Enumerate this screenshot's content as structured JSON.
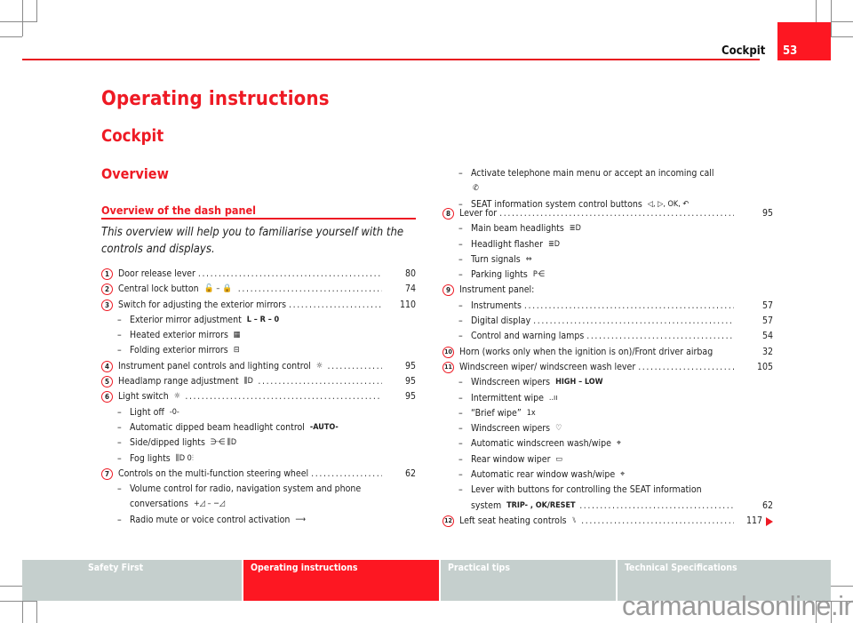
{
  "header": {
    "chapter": "Cockpit",
    "page_number": "53"
  },
  "titles": {
    "h1": "Operating instructions",
    "h2": "Cockpit",
    "h3": "Overview",
    "h4": "Overview of the dash panel",
    "intro": "This overview will help you to familiarise yourself with the controls and displays."
  },
  "left_items": [
    {
      "num": "1",
      "text": "Door release lever",
      "icon": "",
      "page": "80"
    },
    {
      "num": "2",
      "text": "Central lock button",
      "icon": "unlock-lock-icon",
      "glyph": "🔓 – 🔒",
      "page": "74"
    },
    {
      "num": "3",
      "text": "Switch for adjusting the exterior mirrors",
      "page": "110",
      "subs": [
        {
          "text": "Exterior mirror adjustment",
          "glyph": "L – R – 0",
          "icon": "mirror-select-icon"
        },
        {
          "text": "Heated exterior mirrors",
          "glyph": "▦",
          "icon": "heated-mirror-icon"
        },
        {
          "text": "Folding exterior mirrors",
          "glyph": "⊟",
          "icon": "folding-mirror-icon"
        }
      ]
    },
    {
      "num": "4",
      "text": "Instrument panel controls and lighting control",
      "glyph": "☼",
      "icon": "panel-lighting-icon",
      "page": "95"
    },
    {
      "num": "5",
      "text": "Headlamp range adjustment",
      "glyph": "⫼D",
      "icon": "headlamp-range-icon",
      "page": "95"
    },
    {
      "num": "6",
      "text": "Light switch",
      "glyph": "☼",
      "icon": "light-switch-icon",
      "page": "95",
      "subs": [
        {
          "text": "Light off",
          "glyph": "-0-",
          "icon": "light-off-icon"
        },
        {
          "text": "Automatic dipped beam headlight control",
          "glyph": "-AUTO-",
          "icon": "auto-light-icon"
        },
        {
          "text": "Side/dipped lights",
          "glyph": "⋺⋲ ⫼D",
          "icon": "side-dipped-lights-icon"
        },
        {
          "text": "Fog lights",
          "glyph": "⫼D 0⫶",
          "icon": "fog-lights-icon"
        }
      ]
    },
    {
      "num": "7",
      "text": "Controls on the multi-function steering wheel",
      "page": "62",
      "subs": [
        {
          "text": "Volume control for radio, navigation system and phone",
          "text2": "conversations",
          "glyph": "+◿ – −◿",
          "icon": "volume-icon"
        },
        {
          "text": "Radio mute or voice control activation",
          "glyph": "⟶",
          "icon": "mute-voice-icon"
        }
      ]
    }
  ],
  "right_continued": [
    {
      "text": "Activate telephone main menu or accept an incoming call",
      "glyph": "✆",
      "icon": "phone-icon"
    },
    {
      "text": "SEAT information system control buttons",
      "glyph": "◁, ▷, OK, ↶",
      "icon": "nav-buttons-icon"
    }
  ],
  "right_items": [
    {
      "num": "8",
      "text": "Lever for",
      "page": "95",
      "subs": [
        {
          "text": "Main beam headlights",
          "glyph": "≣D",
          "icon": "main-beam-icon"
        },
        {
          "text": "Headlight flasher",
          "glyph": "≣D",
          "icon": "flasher-icon"
        },
        {
          "text": "Turn signals",
          "glyph": "⇔",
          "icon": "turn-signal-icon"
        },
        {
          "text": "Parking lights",
          "glyph": "P⋲",
          "icon": "parking-lights-icon"
        }
      ]
    },
    {
      "num": "9",
      "text": "Instrument panel:",
      "page": "",
      "subs": [
        {
          "text": "Instruments",
          "page": "57"
        },
        {
          "text": "Digital display",
          "page": "57"
        },
        {
          "text": "Control and warning lamps",
          "page": "54"
        }
      ]
    },
    {
      "num": "10",
      "text": "Horn (works only when the ignition is on)/Front driver airbag",
      "page": "32",
      "nodots": true
    },
    {
      "num": "11",
      "text": "Windscreen wiper/ windscreen wash lever",
      "page": "105",
      "subs": [
        {
          "text": "Windscreen wipers",
          "glyph": "HIGH – LOW",
          "icon": "wiper-speed-icon"
        },
        {
          "text": "Intermittent wipe",
          "glyph": "..ıı",
          "icon": "intermittent-wipe-icon"
        },
        {
          "text": "“Brief wipe”",
          "glyph": "1x",
          "icon": "brief-wipe-icon"
        },
        {
          "text": "Windscreen wipers",
          "glyph": "♡",
          "icon": "windscreen-wiper-icon"
        },
        {
          "text": "Automatic windscreen wash/wipe",
          "glyph": "⌖",
          "icon": "auto-wash-icon"
        },
        {
          "text": "Rear window wiper",
          "glyph": "▭",
          "icon": "rear-wiper-icon"
        },
        {
          "text": "Automatic rear window wash/wipe",
          "glyph": "⌖",
          "icon": "rear-wash-icon"
        },
        {
          "text": "Lever with buttons for controlling the SEAT information",
          "text2": "system",
          "glyph": "TRIP- , OK/RESET",
          "icon": "trip-reset-icon",
          "page": "62"
        }
      ]
    },
    {
      "num": "12",
      "text": "Left seat heating controls",
      "glyph": "⑊",
      "icon": "seat-heating-icon",
      "page": "117",
      "continues": true
    }
  ],
  "footer_tabs": [
    {
      "label": "Safety First",
      "active": false
    },
    {
      "label": "Operating instructions",
      "active": true
    },
    {
      "label": "Practical tips",
      "active": false
    },
    {
      "label": "Technical Specifications",
      "active": false
    }
  ],
  "watermark": "carmanualsonline.info",
  "colors": {
    "accent": "#ee1a24",
    "tab_bg": "#c5cfcd",
    "active_tab": "#fd1722"
  }
}
